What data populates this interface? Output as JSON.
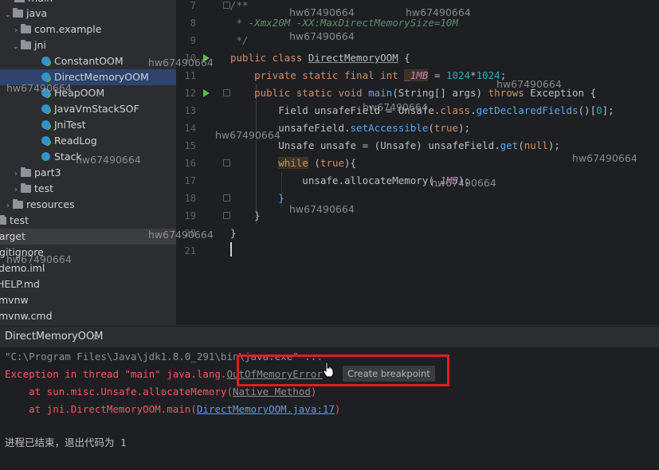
{
  "tree": {
    "items": [
      {
        "label": "main"
      },
      {
        "label": "java"
      },
      {
        "label": "com.example"
      },
      {
        "label": "jni"
      },
      {
        "label": "ConstantOOM"
      },
      {
        "label": "DirectMemoryOOM"
      },
      {
        "label": "HeapOOM"
      },
      {
        "label": "JavaVmStackSOF"
      },
      {
        "label": "JniTest"
      },
      {
        "label": "ReadLog"
      },
      {
        "label": "Stack"
      },
      {
        "label": "part3"
      },
      {
        "label": "test"
      },
      {
        "label": "resources"
      },
      {
        "label": "test"
      },
      {
        "label": "target"
      },
      {
        "label": ".gitignore"
      },
      {
        "label": "demo.iml"
      },
      {
        "label": "HELP.md"
      },
      {
        "label": "mvnw"
      },
      {
        "label": "mvnw.cmd"
      }
    ]
  },
  "editor": {
    "line_numbers": [
      "7",
      "8",
      "9",
      "10",
      "11",
      "12",
      "13",
      "14",
      "15",
      "16",
      "17",
      "18",
      "19",
      "20",
      "21"
    ],
    "code": {
      "l7": "/**",
      "l8": " * -Xmx20M -XX:MaxDirectMemorySize=10M",
      "l9": " */",
      "l10_kw": "public class ",
      "l10_name": "DirectMemoryOOM",
      "l10_end": " {",
      "l11_kw": "    private static final int ",
      "l11_field": "_1MB",
      "l11_mid": " = ",
      "l11_num": "1024",
      "l11_op": "*",
      "l11_num2": "1024",
      "l11_end": ";",
      "l12_kw": "    public static void ",
      "l12_name": "main",
      "l12_args": "(String[] args) ",
      "l12_throws": "throws",
      "l12_end": " Exception {",
      "l13_a": "        Field unsafeField = Unsafe.",
      "l13_kw": "class",
      "l13_b": ".",
      "l13_m": "getDeclaredFields",
      "l13_c": "()[",
      "l13_num": "0",
      "l13_d": "];",
      "l14_a": "        unsafeField.",
      "l14_m": "setAccessible",
      "l14_b": "(",
      "l14_kw": "true",
      "l14_c": ");",
      "l15_a": "        Unsafe unsafe = (Unsafe) unsafeField.",
      "l15_m": "get",
      "l15_b": "(",
      "l15_kw": "null",
      "l15_c": ");",
      "l16_kw": "while",
      "l16_a": " (",
      "l16_kw2": "true",
      "l16_b": "){",
      "l17_a": "            unsafe.",
      "l17_m": "allocateMemory",
      "l17_b": "(",
      "l17_f": "_1MB",
      "l17_c": ");",
      "l18": "        }",
      "l19": "    }",
      "l20": "}",
      "l21": ""
    }
  },
  "run_panel": {
    "tab_label": "DirectMemoryOOM",
    "tab_close": "×",
    "lines": {
      "cmd": "\"C:\\Program Files\\Java\\jdk1.8.0_291\\bin\\java.exe\" ...",
      "err_prefix": "Exception in thread \"main\" java.lang.",
      "err_link": "OutOfMemoryError",
      "trace1_a": "    at sun.misc.Unsafe.allocateMemory(",
      "trace1_link": "Native Method",
      "trace1_b": ")",
      "trace2_a": "    at jni.DirectMemoryOOM.main(",
      "trace2_link": "DirectMemoryOOM.java:17",
      "trace2_b": ")",
      "exit": "进程已结束，退出代码为 1"
    },
    "tooltip": "Create breakpoint"
  },
  "watermark": "hw67490664",
  "colors": {
    "accent_selection": "#2e436e",
    "error_red": "#f75464",
    "highlight_box": "#e01c24",
    "run_green": "#5fb847"
  }
}
